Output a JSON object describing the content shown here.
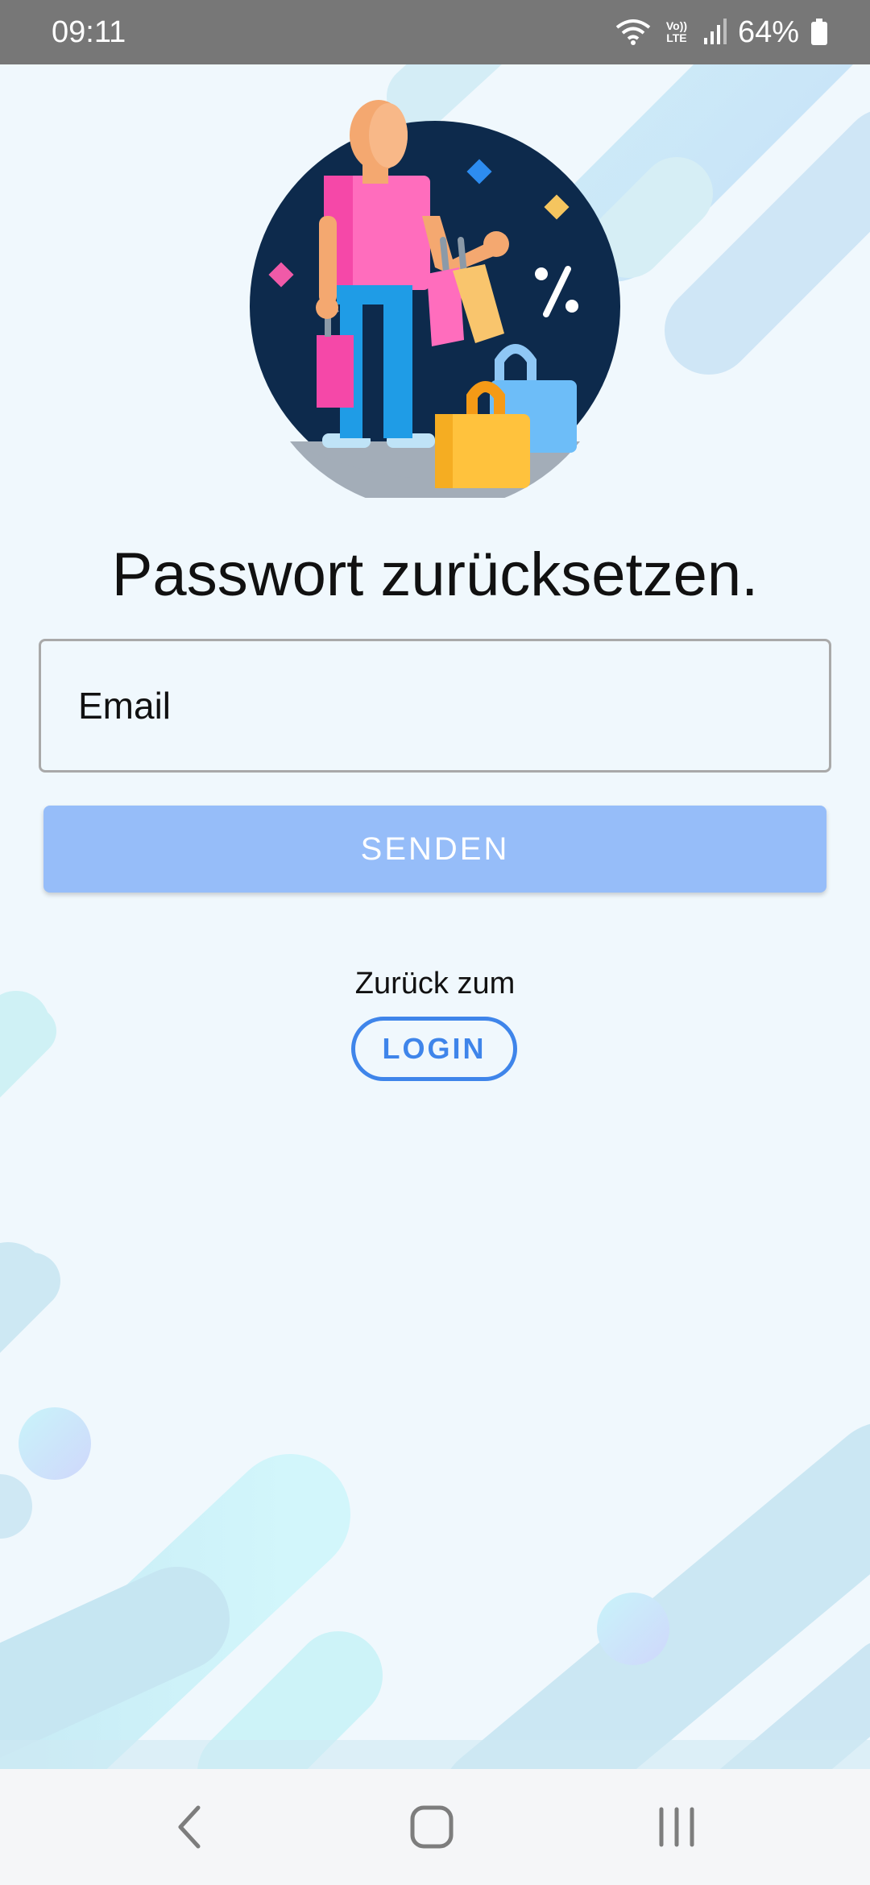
{
  "status_bar": {
    "time": "09:11",
    "network_label": "Vo)) LTE",
    "battery": "64%",
    "icons": [
      "wifi-icon",
      "volte-icon",
      "signal-icon",
      "battery-icon"
    ]
  },
  "hero": {
    "illustration": "shopping-person-illustration"
  },
  "page": {
    "title": "Passwort zurücksetzen."
  },
  "form": {
    "email_placeholder": "Email",
    "email_value": "",
    "send_label": "SENDEN"
  },
  "footer_link": {
    "prefix": "Zurück zum",
    "login_label": "LOGIN"
  },
  "nav": {
    "icons": [
      "back-icon",
      "home-icon",
      "recents-icon"
    ]
  },
  "colors": {
    "primary": "#3f85ea",
    "button_disabled": "#96bdf9",
    "background": "#f0f8fd",
    "status_bar": "#777777"
  }
}
